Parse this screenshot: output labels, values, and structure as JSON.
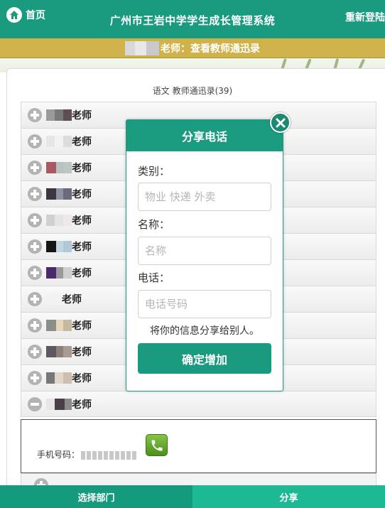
{
  "header": {
    "home_label": "首页",
    "app_title": "广州市王岩中学学生成长管理系统",
    "relogin_label": "重新登陆"
  },
  "subheader": {
    "text": "老师：查看教师通迅录"
  },
  "directory": {
    "caption": "语文 教师通迅录(39)",
    "rows": [
      {
        "name": "老师",
        "state": "collapsed"
      },
      {
        "name": "老师",
        "state": "collapsed"
      },
      {
        "name": "老师",
        "state": "collapsed"
      },
      {
        "name": "老师",
        "state": "collapsed"
      },
      {
        "name": "老师",
        "state": "collapsed"
      },
      {
        "name": "老师",
        "state": "collapsed"
      },
      {
        "name": "老师",
        "state": "collapsed"
      },
      {
        "name": "老师",
        "state": "collapsed"
      },
      {
        "name": "老师",
        "state": "collapsed"
      },
      {
        "name": "老师",
        "state": "collapsed"
      },
      {
        "name": "老师",
        "state": "collapsed"
      },
      {
        "name": "老师",
        "state": "expanded"
      }
    ],
    "detail": {
      "phone_label": "手机号码：",
      "call_icon": "phone-icon"
    }
  },
  "modal": {
    "title": "分享电话",
    "category_label": "类别：",
    "category_placeholder": "物业 快递 外卖",
    "name_label": "名称：",
    "name_placeholder": "名称",
    "phone_label": "电话：",
    "phone_placeholder": "电话号码",
    "note": "将你的信息分享给别人。",
    "confirm_label": "确定增加",
    "close_icon": "close-icon"
  },
  "bottom_nav": {
    "left_label": "选择部门",
    "right_label": "分享"
  },
  "colors": {
    "primary": "#1a9a7f",
    "subheader": "#cfb249",
    "share_tab": "#1db994"
  }
}
